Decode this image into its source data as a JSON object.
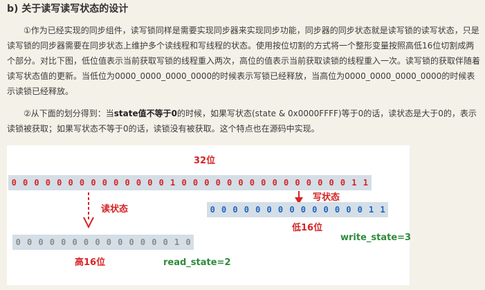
{
  "heading": "b) 关于读写读写状态的设计",
  "para1": "①作为已经实现的同步组件，读写锁同样是需要实现同步器来实现同步功能，同步器的同步状态就是读写锁的读写状态，只是读写锁的同步器需要在同步状态上维护多个读线程和写线程的状态。使用按位切割的方式将一个整形变量按照高低16位切割成两个部分。对比下图，低位值表示当前获取写锁的线程重入两次，高位的值表示当前获取读锁的线程重入一次。读写锁的获取伴随着读写状态值的更新。当低位为0000_0000_0000_0000的时候表示写锁已经释放，当高位为0000_0000_0000_0000的时候表示读锁已经释放。",
  "para2_before": "②从下面的划分得到：当",
  "para2_bold": "state值不等于0",
  "para2_after": "的时候，如果写状态(state & 0x0000FFFF)等于0的话，读状态是大于0的，表示读锁被获取；如果写状态不等于0的话，读锁没有被获取。这个特点也在源码中实现。",
  "diagram": {
    "label_32": "32位",
    "label_read": "读状态",
    "label_write": "写状态",
    "label_low": "低16位",
    "label_high": "高16位",
    "read_state": "read_state=2",
    "write_state": "write_state=3",
    "bits32": [
      "0",
      "0",
      "0",
      "0",
      "0",
      "0",
      "0",
      "0",
      "0",
      "0",
      "0",
      "0",
      "0",
      "0",
      "1",
      "0",
      "0",
      "0",
      "0",
      "0",
      "0",
      "0",
      "0",
      "0",
      "0",
      "0",
      "0",
      "0",
      "0",
      "0",
      "1",
      "1"
    ],
    "bits_low": [
      "0",
      "0",
      "0",
      "0",
      "0",
      "0",
      "0",
      "0",
      "0",
      "0",
      "0",
      "0",
      "0",
      "0",
      "1",
      "1"
    ],
    "bits_high": [
      "0",
      "0",
      "0",
      "0",
      "0",
      "0",
      "0",
      "0",
      "0",
      "0",
      "0",
      "0",
      "0",
      "0",
      "1",
      "0"
    ]
  },
  "colors": {
    "background": "#f4f1e8",
    "red": "#d62424",
    "blue": "#1d63c4",
    "green": "#2e8b3a",
    "bit_row_bg": "#d4dee6"
  }
}
